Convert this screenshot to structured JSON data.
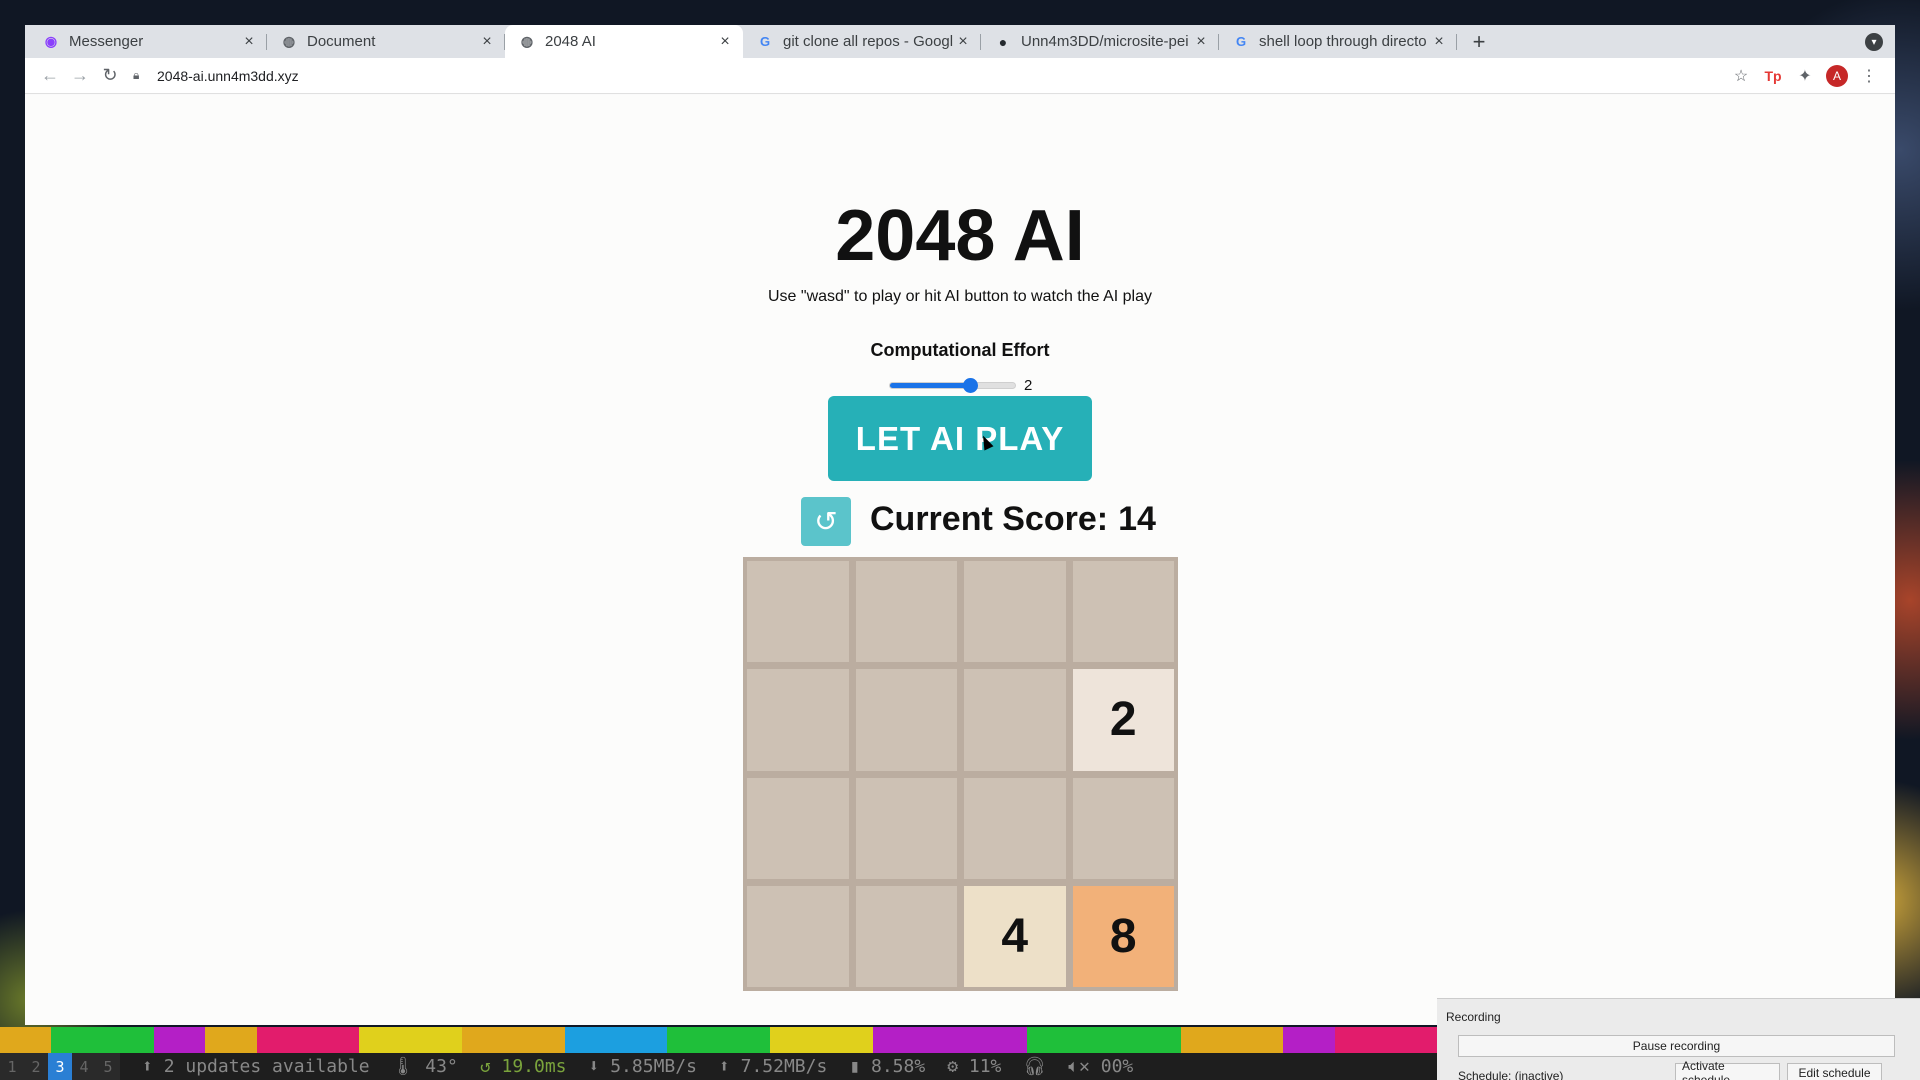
{
  "browser": {
    "tabs": [
      {
        "title": "Messenger",
        "icon": "messenger-icon",
        "active": false
      },
      {
        "title": "Document",
        "icon": "globe-icon",
        "active": false
      },
      {
        "title": "2048 AI",
        "icon": "globe-icon",
        "active": true
      },
      {
        "title": "git clone all repos - Googl",
        "icon": "google-icon",
        "active": false
      },
      {
        "title": "Unn4m3DD/microsite-pei",
        "icon": "github-icon",
        "active": false
      },
      {
        "title": "shell loop through directo",
        "icon": "google-icon",
        "active": false
      }
    ],
    "url": "2048-ai.unn4m3dd.xyz",
    "profile_initial": "A"
  },
  "page": {
    "title": "2048 AI",
    "subtitle": "Use \"wasd\" to play or hit AI button to watch the AI play",
    "effort_label": "Computational Effort",
    "effort_value": "2",
    "effort_fraction": 0.64,
    "ai_button": "LET AI PLAY",
    "score_label": "Current Score:",
    "score_value": "14",
    "board": [
      [
        "",
        "",
        "",
        ""
      ],
      [
        "",
        "",
        "",
        "2"
      ],
      [
        "",
        "",
        "",
        ""
      ],
      [
        "",
        "",
        "4",
        "8"
      ]
    ],
    "tile_colors": {
      "2": "#eee4da",
      "4": "#ede0c8",
      "8": "#f2b179",
      "empty": "#cdc1b4"
    }
  },
  "statusbar": {
    "workspaces": [
      "1",
      "2",
      "3",
      "4",
      "5"
    ],
    "active_workspace": "3",
    "updates": "2 updates available",
    "temp": "43°",
    "ping": "19.0ms",
    "down": "5.85MB/s",
    "up": "7.52MB/s",
    "mem": "8.58%",
    "cpu": "11%",
    "volume": "00%"
  },
  "recording": {
    "title": "Recording",
    "pause": "Pause recording",
    "schedule": "Schedule: (inactive)",
    "activate": "Activate schedule",
    "edit": "Edit schedule"
  }
}
